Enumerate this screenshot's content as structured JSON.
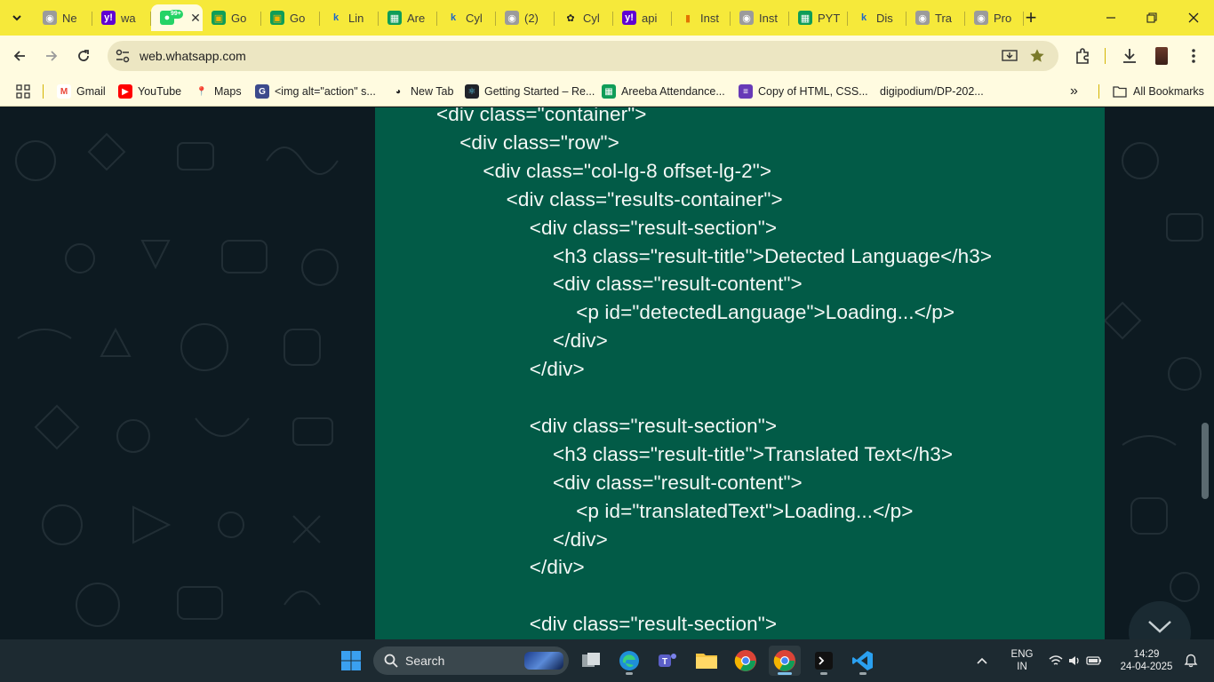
{
  "browser": {
    "tabs": [
      {
        "label": "Ne",
        "icon": "gray-globe-icon"
      },
      {
        "label": "wa",
        "icon": "yahoo-icon"
      },
      {
        "label": "",
        "icon": "whatsapp-icon",
        "badge": "99+",
        "active": true
      },
      {
        "label": "Go",
        "icon": "google-classroom-icon"
      },
      {
        "label": "Go",
        "icon": "google-classroom-icon"
      },
      {
        "label": "Lin",
        "icon": "k-icon"
      },
      {
        "label": "Are",
        "icon": "sheets-icon"
      },
      {
        "label": "Cyl",
        "icon": "k-icon"
      },
      {
        "label": "(2)",
        "icon": "gray-globe-icon"
      },
      {
        "label": "Cyl",
        "icon": "openai-icon"
      },
      {
        "label": "api",
        "icon": "yahoo-icon"
      },
      {
        "label": "Inst",
        "icon": "analytics-icon"
      },
      {
        "label": "Inst",
        "icon": "gray-globe-icon"
      },
      {
        "label": "PYT",
        "icon": "sheets-icon"
      },
      {
        "label": "Dis",
        "icon": "k-icon"
      },
      {
        "label": "Tra",
        "icon": "gray-globe-icon"
      },
      {
        "label": "Pro",
        "icon": "gray-globe-icon"
      }
    ],
    "url": "web.whatsapp.com",
    "bookmarks": [
      {
        "label": "Gmail",
        "icon": "gmail-icon"
      },
      {
        "label": "YouTube",
        "icon": "youtube-icon"
      },
      {
        "label": "Maps",
        "icon": "maps-icon"
      },
      {
        "label": "<img alt=\"action\" s...",
        "icon": "g-icon"
      },
      {
        "label": "New Tab",
        "icon": "globe-icon"
      },
      {
        "label": "Getting Started – Re...",
        "icon": "react-icon"
      },
      {
        "label": "Areeba Attendance...",
        "icon": "sheets-icon"
      },
      {
        "label": "Copy of HTML, CSS...",
        "icon": "forms-icon"
      },
      {
        "label": "digipodium/DP-202...",
        "icon": "blank-icon"
      }
    ],
    "all_bookmarks_label": "All Bookmarks",
    "more_label": "»"
  },
  "code": {
    "lines": [
      "<div class=\"container\">",
      "<div class=\"row\">",
      "<div class=\"col-lg-8 offset-lg-2\">",
      "<div class=\"results-container\">",
      "<div class=\"result-section\">",
      "<h3 class=\"result-title\">Detected Language</h3>",
      "<div class=\"result-content\">",
      "<p id=\"detectedLanguage\">Loading...</p>",
      "</div>",
      "</div>",
      "",
      "<div class=\"result-section\">",
      "<h3 class=\"result-title\">Translated Text</h3>",
      "<div class=\"result-content\">",
      "<p id=\"translatedText\">Loading...</p>",
      "</div>",
      "</div>",
      "",
      "<div class=\"result-section\">"
    ]
  },
  "taskbar": {
    "search_label": "Search",
    "lang_line1": "ENG",
    "lang_line2": "IN",
    "time": "14:29",
    "date": "24-04-2025"
  },
  "colors": {
    "chrome_frame": "#f6e93a",
    "toolbar": "#fffbe0",
    "code_panel": "#025b47",
    "page_bg": "#0d1a21",
    "taskbar": "#1d2a31"
  }
}
